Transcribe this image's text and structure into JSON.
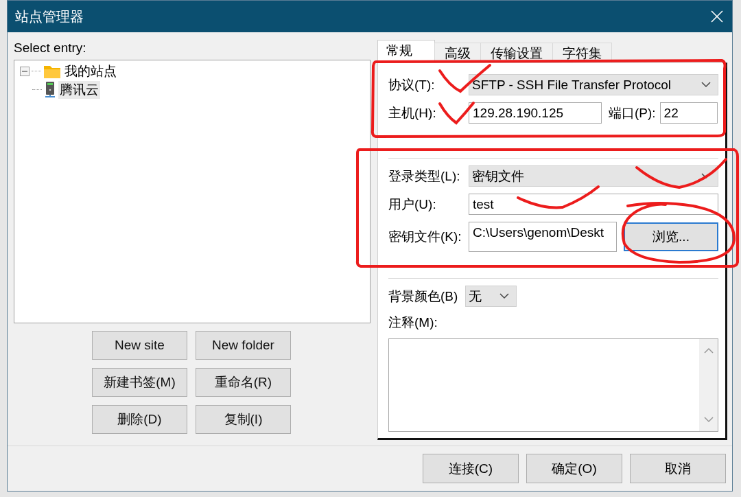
{
  "window": {
    "title": "站点管理器"
  },
  "entries": {
    "label": "Select entry:",
    "tree": [
      {
        "label": "我的站点",
        "kind": "folder",
        "expanded": true,
        "selected": false,
        "children": [
          {
            "label": "腾讯云",
            "kind": "server",
            "selected": true
          }
        ]
      }
    ]
  },
  "entry_buttons": [
    "New site",
    "New folder",
    "新建书签(M)",
    "重命名(R)",
    "删除(D)",
    "复制(I)"
  ],
  "tabs": [
    {
      "label": "常规",
      "selected": true
    },
    {
      "label": "高级",
      "selected": false
    },
    {
      "label": "传输设置",
      "selected": false
    },
    {
      "label": "字符集",
      "selected": false
    }
  ],
  "general": {
    "protocol": {
      "label": "协议(T):",
      "value": "SFTP - SSH File Transfer Protocol"
    },
    "host": {
      "label": "主机(H):",
      "value": "129.28.190.125"
    },
    "port": {
      "label": "端口(P):",
      "value": "22"
    },
    "login_type": {
      "label": "登录类型(L):",
      "value": "密钥文件"
    },
    "user": {
      "label": "用户(U):",
      "value": "test"
    },
    "key_file": {
      "label": "密钥文件(K):",
      "value": "C:\\Users\\genom\\Deskt",
      "button": "浏览..."
    },
    "background_color": {
      "label": "背景颜色(B)",
      "value": "无"
    },
    "comments": {
      "label": "注释(M):"
    }
  },
  "footer_buttons": [
    "连接(C)",
    "确定(O)",
    "取消"
  ]
}
